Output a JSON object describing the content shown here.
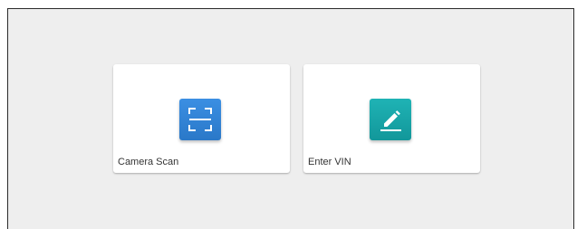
{
  "options": [
    {
      "label": "Camera Scan",
      "icon": "scan-frame-icon",
      "tile_color_top": "#3b8fe3",
      "tile_color_bottom": "#2a78c8"
    },
    {
      "label": "Enter VIN",
      "icon": "pencil-edit-icon",
      "tile_color_top": "#1fb3b5",
      "tile_color_bottom": "#12979a"
    }
  ]
}
